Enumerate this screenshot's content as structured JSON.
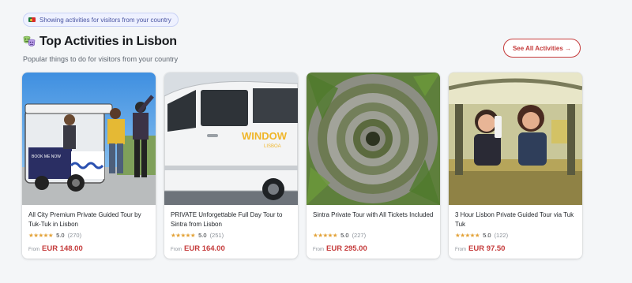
{
  "notice": {
    "text": "Showing activities for visitors from your country"
  },
  "section": {
    "title": "Top Activities in Lisbon",
    "subtitle": "Popular things to do for visitors from your country",
    "see_all_label": "See All Activities →"
  },
  "cards": [
    {
      "title": "All City Premium Private Guided Tour by Tuk-Tuk in Lisbon",
      "stars": "★★★★★",
      "score": "5.0",
      "count": "(270)",
      "from": "From",
      "price": "EUR 148.00",
      "photo": "tuk-tuk tour group photo"
    },
    {
      "title": "PRIVATE Unforgettable Full Day Tour to Sintra from Lisbon",
      "stars": "★★★★★",
      "score": "5.0",
      "count": "(251)",
      "from": "From",
      "price": "EUR 164.00",
      "photo": "white van photo"
    },
    {
      "title": "Sintra Private Tour with All Tickets Included",
      "stars": "★★★★★",
      "score": "5.0",
      "count": "(227)",
      "from": "From",
      "price": "EUR 295.00",
      "photo": "initiation well photo"
    },
    {
      "title": "3 Hour Lisbon Private Guided Tour via Tuk Tuk",
      "stars": "★★★★★",
      "score": "5.0",
      "count": "(122)",
      "from": "From",
      "price": "EUR 97.50",
      "photo": "tuk-tuk selfie photo"
    }
  ],
  "colors": {
    "accent": "#c53b3b",
    "star": "#e3a339",
    "pill_bg": "#eef1ff",
    "pill_text": "#4a55a2"
  },
  "icons": {
    "notice": "portugal-flag-icon",
    "title": "theater-masks-icon"
  }
}
